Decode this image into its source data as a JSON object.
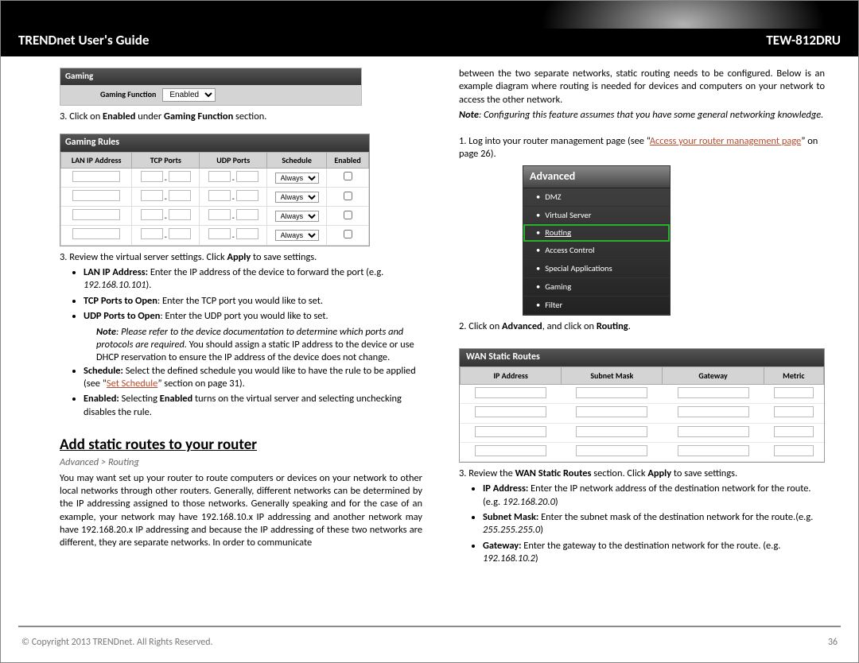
{
  "header": {
    "title": "TRENDnet User's Guide",
    "model": "TEW-812DRU"
  },
  "gaming_panel": {
    "title": "Gaming",
    "label": "Gaming Function",
    "value": "Enabled"
  },
  "step3a_pre": "3. Click on ",
  "step3a_b1": "Enabled",
  "step3a_mid": " under ",
  "step3a_b2": "Gaming Function",
  "step3a_post": " section.",
  "rules_panel": {
    "title": "Gaming Rules",
    "cols": {
      "lan": "LAN IP Address",
      "tcp": "TCP Ports",
      "udp": "UDP Ports",
      "sched": "Schedule",
      "en": "Enabled"
    },
    "schedule_option": "Always"
  },
  "step3b_pre": "3. Review the virtual server settings. Click ",
  "step3b_b": "Apply",
  "step3b_post": " to save settings.",
  "bullets_left": {
    "lan_b": "LAN IP Address:",
    "lan_t": " Enter the IP address of the device to forward the port (e.g. ",
    "lan_i": "192.168.10.101",
    "lan_e": ").",
    "tcp_b": "TCP Ports to Open",
    "tcp_t": ": Enter the TCP port you would like to set.",
    "udp_b": "UDP Ports to Open",
    "udp_t": ": Enter the UDP port you would like to set.",
    "note_b": "Note",
    "note_i": ": Please refer to the device documentation to determine which ports and protocols are required.",
    "note_t": " You should assign a static IP address to the device or use DHCP reservation to ensure the IP address of the device does not change.",
    "sched_b": "Schedule:",
    "sched_t1": " Select the defined schedule you would like to have the rule to be applied (see “",
    "sched_link": "Set Schedule",
    "sched_t2": "” section on page 31).",
    "en_b": "Enabled:",
    "en_t1": " Selecting ",
    "en_b2": "Enabled",
    "en_t2": " turns on the virtual server and selecting unchecking disables the rule."
  },
  "section": {
    "heading": "Add static routes to your router",
    "breadcrumb": "Advanced > Routing",
    "para": "You may want set up your router to route computers or devices on your network to other local networks through other routers. Generally, different networks can be determined by the IP addressing assigned to those networks. Generally speaking and for the case of an example, your network may have 192.168.10.x IP addressing and another network may have 192.168.20.x IP addressing and because the IP addressing of these two networks are different, they are separate networks. In order to communicate"
  },
  "right_top": {
    "cont": "between the two separate networks, static routing needs to be configured. Below is an example diagram where routing is needed for devices and computers on your network to access the other network.",
    "note_b": "Note",
    "note_i": ": Configuring this feature assumes that you have some general networking knowledge."
  },
  "step1": {
    "t1": "1. Log into your router management page (see “",
    "link": "Access your router management page",
    "t2": "” on page 26)."
  },
  "adv_menu": {
    "title": "Advanced",
    "items": [
      "DMZ",
      "Virtual Server",
      "Routing",
      "Access Control",
      "Special Applications",
      "Gaming",
      "Filter"
    ]
  },
  "step2": {
    "t1": "2. Click on ",
    "b1": "Advanced",
    "t2": ", and click on ",
    "b2": "Routing",
    "t3": "."
  },
  "wan_panel": {
    "title": "WAN Static Routes",
    "cols": {
      "ip": "IP Address",
      "mask": "Subnet Mask",
      "gw": "Gateway",
      "metric": "Metric"
    }
  },
  "step3r": {
    "t1": "3. Review the ",
    "b1": "WAN Static Routes",
    "t2": " section. Click ",
    "b2": "Apply",
    "t3": " to save settings."
  },
  "bullets_right": {
    "ip_b": "IP Address:",
    "ip_t": " Enter the IP network address of the destination network for the route. (e.g. ",
    "ip_i": "192.168.20.0",
    "ip_e": ")",
    "mask_b": "Subnet Mask:",
    "mask_t": " Enter the subnet mask of the destination network for the route.(e.g. ",
    "mask_i": "255.255.255.0",
    "mask_e": ")",
    "gw_b": "Gateway:",
    "gw_t": " Enter the gateway to the destination network for the route. (e.g. ",
    "gw_i": "192.168.10.2",
    "gw_e": ")"
  },
  "footer": {
    "copyright": "© Copyright 2013 TRENDnet. All Rights Reserved.",
    "page": "36"
  }
}
